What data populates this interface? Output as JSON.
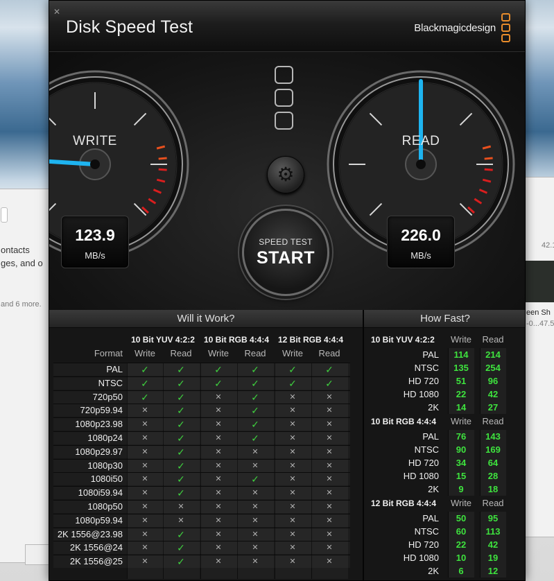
{
  "background": {
    "left_text_1": "ontacts",
    "left_text_2": "ges, and o",
    "left_text_3": "and 6 more.",
    "right_text_1": "42.1",
    "right_text_2": "een Sh",
    "right_text_3": "-0...47.5"
  },
  "app": {
    "title": "Disk Speed Test",
    "brand": "Blackmagicdesign",
    "close_icon": "close-icon",
    "accent_color": "#1eb4f0",
    "logo_color": "#e88c2b"
  },
  "gauges": {
    "write": {
      "label": "WRITE",
      "value": "123.9",
      "unit": "MB/s",
      "level_fraction": 0.18
    },
    "read": {
      "label": "READ",
      "value": "226.0",
      "unit": "MB/s",
      "level_fraction": 0.5
    }
  },
  "start_button": {
    "small_label": "SPEED TEST",
    "big_label": "START"
  },
  "settings_icon": "gear-icon",
  "will_it_work": {
    "title": "Will it Work?",
    "format_label": "Format",
    "groups": [
      "10 Bit YUV 4:2:2",
      "10 Bit RGB 4:4:4",
      "12 Bit RGB 4:4:4"
    ],
    "write_label": "Write",
    "read_label": "Read",
    "formats": [
      "PAL",
      "NTSC",
      "720p50",
      "720p59.94",
      "1080p23.98",
      "1080p24",
      "1080p29.97",
      "1080p30",
      "1080i50",
      "1080i59.94",
      "1080p50",
      "1080p59.94",
      "2K 1556@23.98",
      "2K 1556@24",
      "2K 1556@25"
    ],
    "results": [
      [
        1,
        1,
        1,
        1,
        1,
        1
      ],
      [
        1,
        1,
        1,
        1,
        1,
        1
      ],
      [
        1,
        1,
        0,
        1,
        0,
        0
      ],
      [
        0,
        1,
        0,
        1,
        0,
        0
      ],
      [
        0,
        1,
        0,
        1,
        0,
        0
      ],
      [
        0,
        1,
        0,
        1,
        0,
        0
      ],
      [
        0,
        1,
        0,
        0,
        0,
        0
      ],
      [
        0,
        1,
        0,
        0,
        0,
        0
      ],
      [
        0,
        1,
        0,
        1,
        0,
        0
      ],
      [
        0,
        1,
        0,
        0,
        0,
        0
      ],
      [
        0,
        0,
        0,
        0,
        0,
        0
      ],
      [
        0,
        0,
        0,
        0,
        0,
        0
      ],
      [
        0,
        1,
        0,
        0,
        0,
        0
      ],
      [
        0,
        1,
        0,
        0,
        0,
        0
      ],
      [
        0,
        1,
        0,
        0,
        0,
        0
      ]
    ]
  },
  "how_fast": {
    "title": "How Fast?",
    "write_label": "Write",
    "read_label": "Read",
    "sections": [
      {
        "title": "10 Bit YUV 4:2:2",
        "rows": [
          {
            "label": "PAL",
            "write": "114",
            "read": "214"
          },
          {
            "label": "NTSC",
            "write": "135",
            "read": "254"
          },
          {
            "label": "HD 720",
            "write": "51",
            "read": "96"
          },
          {
            "label": "HD 1080",
            "write": "22",
            "read": "42"
          },
          {
            "label": "2K",
            "write": "14",
            "read": "27"
          }
        ]
      },
      {
        "title": "10 Bit RGB 4:4:4",
        "rows": [
          {
            "label": "PAL",
            "write": "76",
            "read": "143"
          },
          {
            "label": "NTSC",
            "write": "90",
            "read": "169"
          },
          {
            "label": "HD 720",
            "write": "34",
            "read": "64"
          },
          {
            "label": "HD 1080",
            "write": "15",
            "read": "28"
          },
          {
            "label": "2K",
            "write": "9",
            "read": "18"
          }
        ]
      },
      {
        "title": "12 Bit RGB 4:4:4",
        "rows": [
          {
            "label": "PAL",
            "write": "50",
            "read": "95"
          },
          {
            "label": "NTSC",
            "write": "60",
            "read": "113"
          },
          {
            "label": "HD 720",
            "write": "22",
            "read": "42"
          },
          {
            "label": "HD 1080",
            "write": "10",
            "read": "19"
          },
          {
            "label": "2K",
            "write": "6",
            "read": "12"
          }
        ]
      }
    ]
  }
}
